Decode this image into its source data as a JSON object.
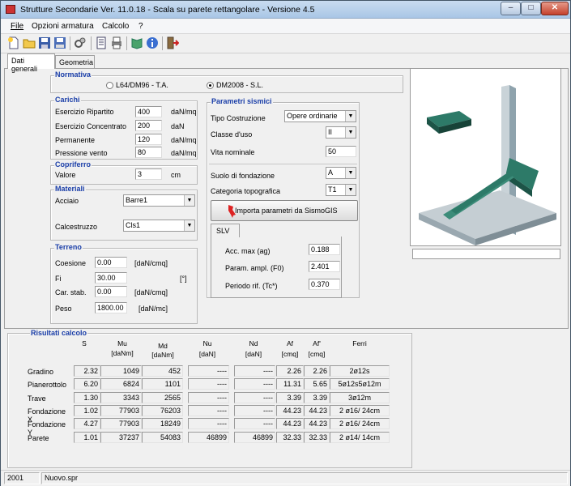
{
  "window": {
    "title": "Strutture Secondarie Ver. 11.0.18 - Scala su parete rettangolare - Versione 4.5"
  },
  "menu": {
    "items": [
      "File",
      "Opzioni armatura",
      "Calcolo",
      "?"
    ]
  },
  "tabs": [
    "Dati generali",
    "Geometria"
  ],
  "normativa": {
    "title": "Normativa",
    "option1": "L64/DM96 - T.A.",
    "option2": "DM2008 - S.L.",
    "selected": "DM2008 - S.L."
  },
  "carichi": {
    "title": "Carichi",
    "rows": [
      {
        "label": "Esercizio Ripartito",
        "value": "400",
        "unit": "daN/mq"
      },
      {
        "label": "Esercizio Concentrato",
        "value": "200",
        "unit": "daN"
      },
      {
        "label": "Permanente",
        "value": "120",
        "unit": "daN/mq"
      },
      {
        "label": "Pressione vento",
        "value": "80",
        "unit": "daN/mq"
      }
    ]
  },
  "copriferro": {
    "title": "Copriferro",
    "label": "Valore",
    "value": "3",
    "unit": "cm"
  },
  "materiali": {
    "title": "Materiali",
    "acciaio_label": "Acciaio",
    "acciaio_value": "Barre1",
    "cls_label": "Calcestruzzo",
    "cls_value": "Cls1"
  },
  "terreno": {
    "title": "Terreno",
    "rows": [
      {
        "label": "Coesione",
        "value": "0.00",
        "unit": "[daN/cmq]"
      },
      {
        "label": "Fi",
        "value": "30.00",
        "unit": "[°]"
      },
      {
        "label": "Car. stab.",
        "value": "0.00",
        "unit": "[daN/cmq]"
      },
      {
        "label": "Peso",
        "value": "1800.00",
        "unit": "[daN/mc]"
      }
    ]
  },
  "sismici": {
    "title": "Parametri sismici",
    "tipo_label": "Tipo Costruzione",
    "tipo_value": "Opere ordinarie",
    "classe_label": "Classe d'uso",
    "classe_value": "II",
    "vita_label": "Vita nominale",
    "vita_value": "50",
    "suolo_label": "Suolo di fondazione",
    "suolo_value": "A",
    "cat_label": "Categoria topografica",
    "cat_value": "T1",
    "import_button": "Importa parametri da SismoGIS",
    "slv_tab": "SLV",
    "acc_label": "Acc. max (ag)",
    "acc_value": "0.188",
    "ampl_label": "Param. ampl.  (F0)",
    "ampl_value": "2.401",
    "period_label": "Periodo rif.  (Tc*)",
    "period_value": "0.370"
  },
  "risultati": {
    "title": "Risultati calcolo",
    "headers": [
      {
        "l1": "S",
        "l2": ""
      },
      {
        "l1": "Mu",
        "l2": "[daNm]"
      },
      {
        "l1": "Md",
        "l2": "[daNm]"
      },
      {
        "l1": "Nu",
        "l2": "[daN]"
      },
      {
        "l1": "Nd",
        "l2": "[daN]"
      },
      {
        "l1": "Af",
        "l2": "[cmq]"
      },
      {
        "l1": "Af'",
        "l2": "[cmq]"
      },
      {
        "l1": "Ferri",
        "l2": ""
      }
    ],
    "rows": [
      {
        "name": "Gradino",
        "cells": [
          "2.32",
          "1049",
          "452",
          "----",
          "----",
          "2.26",
          "2.26",
          "2ø12s"
        ]
      },
      {
        "name": "Pianerottolo",
        "cells": [
          "6.20",
          "6824",
          "1101",
          "----",
          "----",
          "11.31",
          "5.65",
          "5ø12s5ø12m"
        ]
      },
      {
        "name": "Trave",
        "cells": [
          "1.30",
          "3343",
          "2565",
          "----",
          "----",
          "3.39",
          "3.39",
          "3ø12m"
        ]
      },
      {
        "name": "Fondazione X",
        "cells": [
          "1.02",
          "77903",
          "76203",
          "----",
          "----",
          "44.23",
          "44.23",
          "2 ø16/ 24cm"
        ]
      },
      {
        "name": "Fondazione Y",
        "cells": [
          "4.27",
          "77903",
          "18249",
          "----",
          "----",
          "44.23",
          "44.23",
          "2 ø16/ 24cm"
        ]
      },
      {
        "name": "Parete",
        "cells": [
          "1.01",
          "37237",
          "54083",
          "46899",
          "46899",
          "32.33",
          "32.33",
          "2 ø14/ 14cm"
        ]
      }
    ]
  },
  "status": {
    "left": "2001",
    "right": "Nuovo.spr"
  }
}
